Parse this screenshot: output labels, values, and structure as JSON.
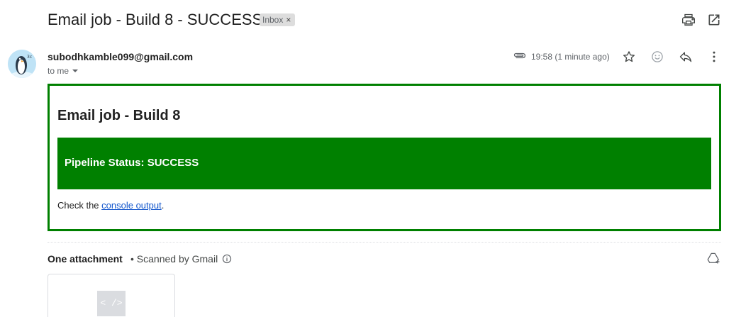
{
  "subject": "Email job - Build 8 - SUCCESS",
  "label_chip": {
    "text": "Inbox",
    "close": "×"
  },
  "sender": {
    "email": "subodhkamble099@gmail.com",
    "to": "to me",
    "time": "19:58 (1 minute ago)"
  },
  "body": {
    "title": "Email job - Build 8",
    "status": "Pipeline Status: SUCCESS",
    "check_prefix": "Check the ",
    "link_text": "console output",
    "check_suffix": "."
  },
  "attachments": {
    "title": "One attachment",
    "scanned": "• Scanned by Gmail",
    "file_icon_text": "< />"
  },
  "icons": {
    "print": "printer-icon",
    "open_new": "open-in-new-window-icon",
    "attachment": "paperclip-icon",
    "star": "star-icon",
    "emoji": "emoji-icon",
    "reply": "reply-icon",
    "more": "more-vert-icon",
    "info": "info-icon",
    "drive": "add-to-drive-icon"
  },
  "colors": {
    "success_green": "#008000",
    "link_blue": "#1155cc",
    "chip_bg": "#dddddd"
  }
}
